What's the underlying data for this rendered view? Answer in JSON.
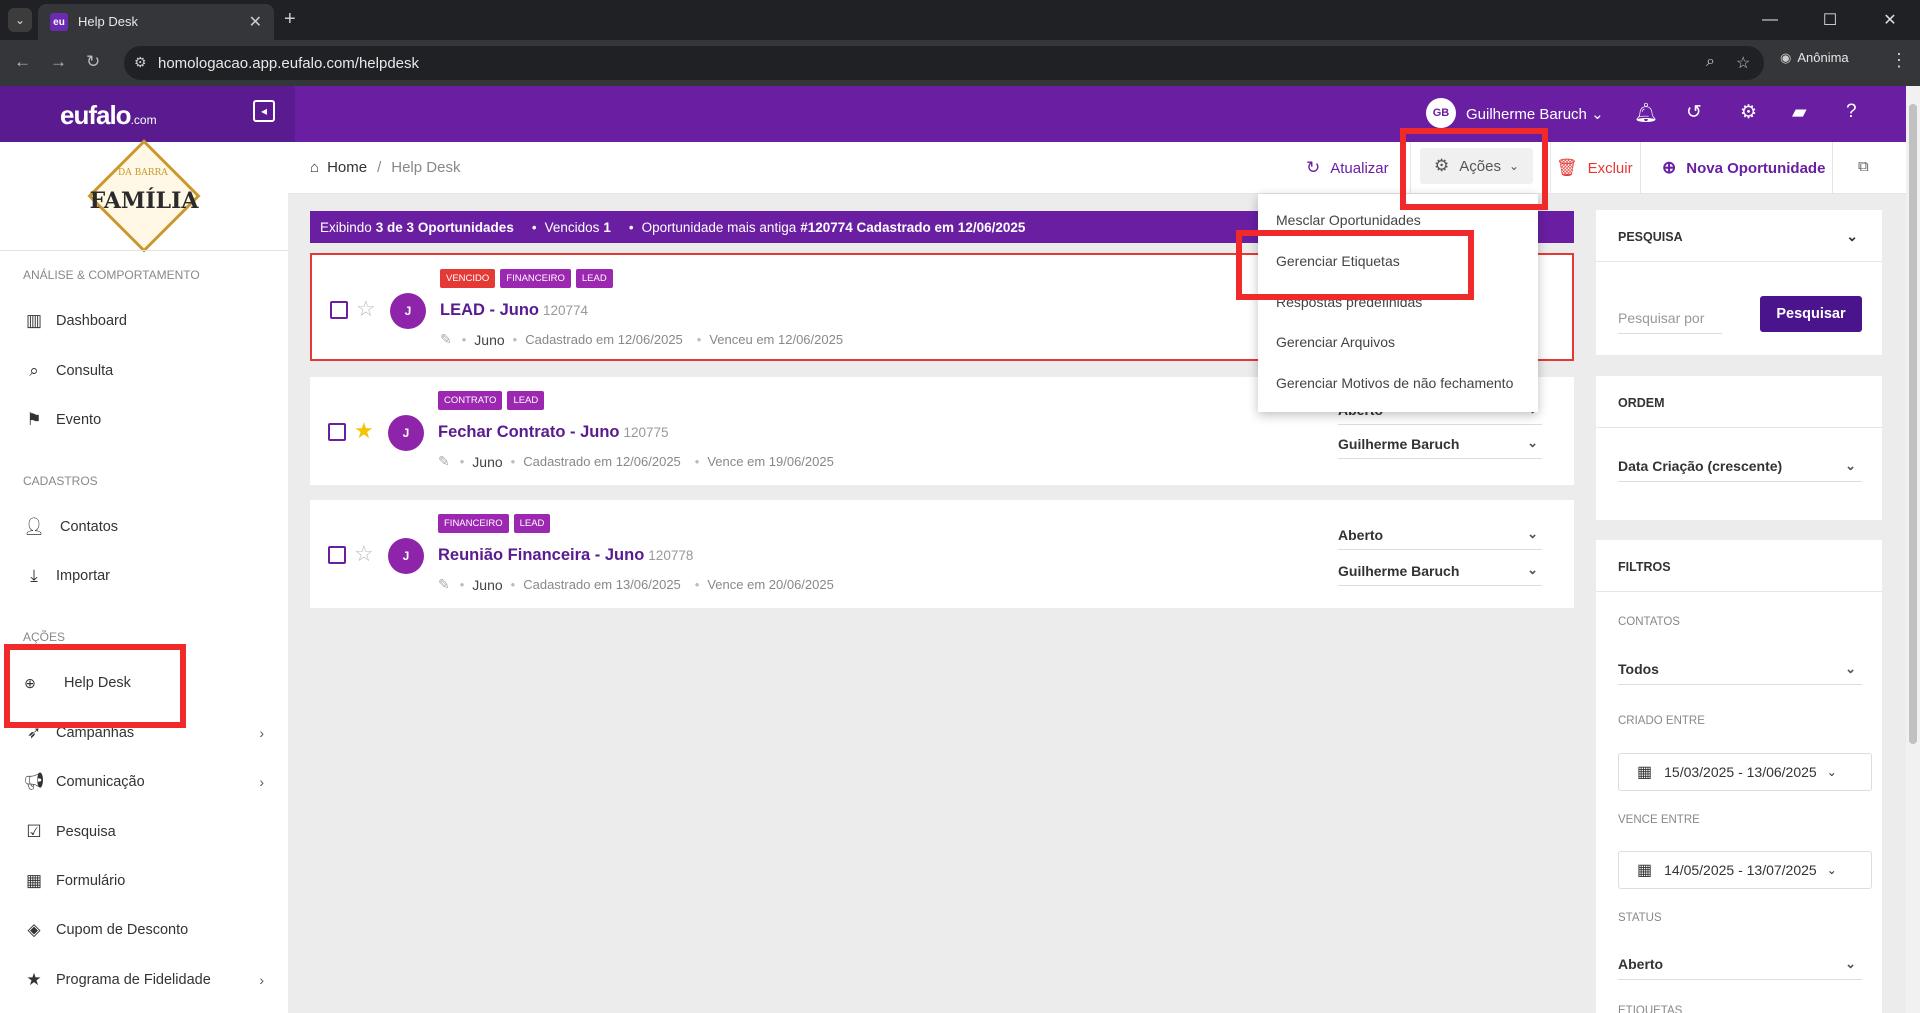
{
  "browser": {
    "tab_title": "Help Desk",
    "tab_favicon": "eu",
    "url": "homologacao.app.eufalo.com/helpdesk",
    "profile_label": "Anônima"
  },
  "header": {
    "logo": "eufalo",
    "logo_suffix": ".com",
    "user_initials": "GB",
    "user_name": "Guilherme Baruch",
    "brand_color": "#6a1fa3"
  },
  "sidebar": {
    "brand_top": "DA BARRA",
    "brand_name": "FAMÍLIA",
    "sections": {
      "analysis": "ANÁLISE & COMPORTAMENTO",
      "registrations": "CADASTROS",
      "actions": "AÇÕES"
    },
    "items": {
      "dashboard": "Dashboard",
      "consulta": "Consulta",
      "evento": "Evento",
      "contatos": "Contatos",
      "importar": "Importar",
      "helpdesk": "Help Desk",
      "campanhas": "Campanhas",
      "comunicacao": "Comunicação",
      "pesquisa": "Pesquisa",
      "formulario": "Formulário",
      "cupom": "Cupom de Desconto",
      "fidelidade": "Programa de Fidelidade"
    }
  },
  "breadcrumb": {
    "home": "Home",
    "sep": "/",
    "current": "Help Desk"
  },
  "toolbar": {
    "refresh": "Atualizar",
    "actions": "Ações",
    "delete": "Excluir",
    "new_opportunity": "Nova Oportunidade"
  },
  "summary": {
    "showing_prefix": "Exibindo",
    "showing_count": "3 de 3 Oportunidades",
    "overdue_label": "Vencidos",
    "overdue_count": "1",
    "oldest_label": "Oportunidade mais antiga",
    "oldest_value": "#120774 Cadastrado em 12/06/2025"
  },
  "actions_menu": [
    "Mesclar Oportunidades",
    "Gerenciar Etiquetas",
    "Respostas predefinidas",
    "Gerenciar Arquivos",
    "Gerenciar Motivos de não fechamento"
  ],
  "cards": [
    {
      "tags": [
        "VENCIDO",
        "FINANCEIRO",
        "LEAD"
      ],
      "avatar": "J",
      "title": "LEAD - Juno",
      "id": "120774",
      "owner": "Juno",
      "created": "Cadastrado em 12/06/2025",
      "due": "Venceu em 12/06/2025",
      "starred": false,
      "status": "",
      "assignee": ""
    },
    {
      "tags": [
        "CONTRATO",
        "LEAD"
      ],
      "avatar": "J",
      "title": "Fechar Contrato - Juno",
      "id": "120775",
      "owner": "Juno",
      "created": "Cadastrado em 12/06/2025",
      "due": "Vence em 19/06/2025",
      "starred": true,
      "status": "Aberto",
      "assignee": "Guilherme Baruch"
    },
    {
      "tags": [
        "FINANCEIRO",
        "LEAD"
      ],
      "avatar": "J",
      "title": "Reunião Financeira - Juno",
      "id": "120778",
      "owner": "Juno",
      "created": "Cadastrado em 13/06/2025",
      "due": "Vence em 20/06/2025",
      "starred": false,
      "status": "Aberto",
      "assignee": "Guilherme Baruch"
    }
  ],
  "search_panel": {
    "title": "PESQUISA",
    "placeholder": "Pesquisar por",
    "button": "Pesquisar"
  },
  "order_panel": {
    "title": "ORDEM",
    "value": "Data Criação (crescente)"
  },
  "filters_panel": {
    "title": "FILTROS",
    "contacts_label": "CONTATOS",
    "contacts_value": "Todos",
    "created_label": "CRIADO ENTRE",
    "created_value": "15/03/2025 - 13/06/2025",
    "due_label": "VENCE ENTRE",
    "due_value": "14/05/2025 - 13/07/2025",
    "status_label": "STATUS",
    "status_value": "Aberto",
    "tags_label": "ETIQUETAS"
  }
}
